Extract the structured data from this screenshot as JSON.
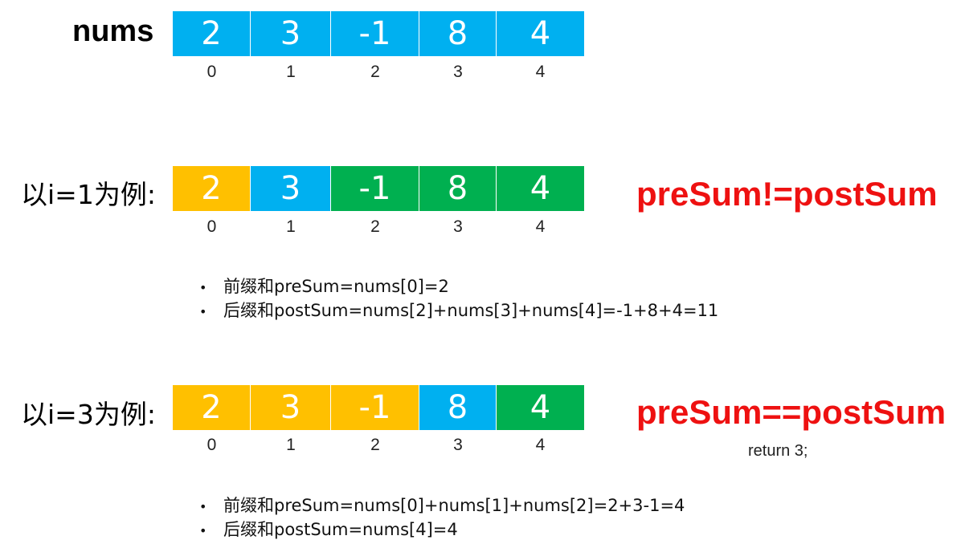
{
  "colors": {
    "blue": "#00b0f0",
    "orange": "#ffc000",
    "green": "#00b050",
    "red": "#ee1111"
  },
  "labels": {
    "nums": "nums",
    "example1": "以i=1为例:",
    "example2": "以i=3为例:"
  },
  "arrays": [
    {
      "cells": [
        {
          "value": "2",
          "color": "#00b0f0"
        },
        {
          "value": "3",
          "color": "#00b0f0"
        },
        {
          "value": "-1",
          "color": "#00b0f0"
        },
        {
          "value": "8",
          "color": "#00b0f0"
        },
        {
          "value": "4",
          "color": "#00b0f0"
        }
      ],
      "indices": [
        "0",
        "1",
        "2",
        "3",
        "4"
      ]
    },
    {
      "cells": [
        {
          "value": "2",
          "color": "#ffc000"
        },
        {
          "value": "3",
          "color": "#00b0f0"
        },
        {
          "value": "-1",
          "color": "#00b050"
        },
        {
          "value": "8",
          "color": "#00b050"
        },
        {
          "value": "4",
          "color": "#00b050"
        }
      ],
      "indices": [
        "0",
        "1",
        "2",
        "3",
        "4"
      ]
    },
    {
      "cells": [
        {
          "value": "2",
          "color": "#ffc000"
        },
        {
          "value": "3",
          "color": "#ffc000"
        },
        {
          "value": "-1",
          "color": "#ffc000"
        },
        {
          "value": "8",
          "color": "#00b0f0"
        },
        {
          "value": "4",
          "color": "#00b050"
        }
      ],
      "indices": [
        "0",
        "1",
        "2",
        "3",
        "4"
      ]
    }
  ],
  "verdicts": {
    "example1": "preSum!=postSum",
    "example2": "preSum==postSum",
    "return_text": "return 3;"
  },
  "bullets": {
    "example1": [
      "前缀和preSum=nums[0]=2",
      "后缀和postSum=nums[2]+nums[3]+nums[4]=-1+8+4=11"
    ],
    "example2": [
      "前缀和preSum=nums[0]+nums[1]+nums[2]=2+3-1=4",
      "后缀和postSum=nums[4]=4"
    ]
  }
}
